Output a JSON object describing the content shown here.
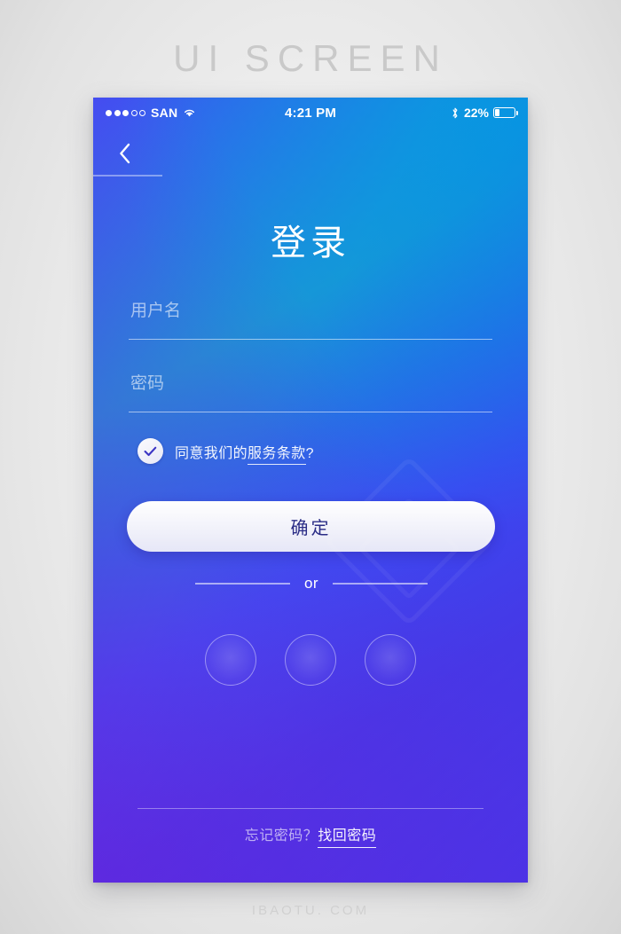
{
  "page": {
    "title": "UI SCREEN",
    "footer": "IBAOTU. COM"
  },
  "colors": {
    "gradient_top_left": "#3f51f3",
    "gradient_top_right": "#1f93d4",
    "gradient_bottom_left": "#6a22d8",
    "gradient_bottom_right": "#3a3ef5",
    "button_text": "#2a2c86",
    "text_on_dark": "#ffffff"
  },
  "statusbar": {
    "carrier": "SAN",
    "signal_filled": 3,
    "signal_total": 5,
    "wifi_icon": "wifi-icon",
    "time": "4:21 PM",
    "bluetooth_icon": "bluetooth-icon",
    "battery_percent": "22%",
    "battery_level": 22
  },
  "navbar": {
    "back_icon": "chevron-left-icon"
  },
  "screen": {
    "title": "登录"
  },
  "form": {
    "username": {
      "placeholder": "用户名",
      "value": ""
    },
    "password": {
      "placeholder": "密码",
      "value": ""
    }
  },
  "terms": {
    "checked": true,
    "check_icon": "check-icon",
    "prefix": "同意我们的",
    "link": "服务条款",
    "suffix": "?"
  },
  "actions": {
    "submit_label": "确定"
  },
  "divider": {
    "or_label": "or"
  },
  "socials": [
    {
      "name": "social-login-1"
    },
    {
      "name": "social-login-2"
    },
    {
      "name": "social-login-3"
    }
  ],
  "footer": {
    "forgot_prefix": "忘记密码？",
    "recover_link": "找回密码"
  }
}
